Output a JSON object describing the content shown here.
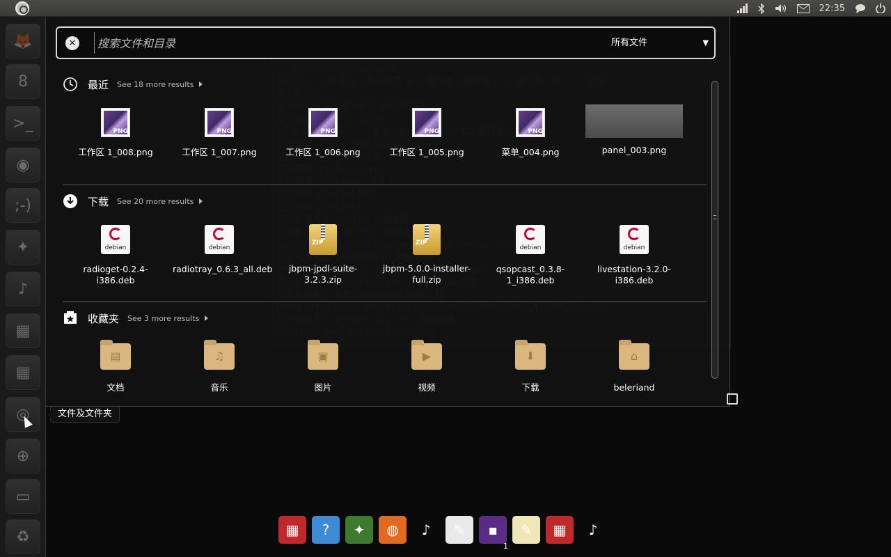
{
  "panel": {
    "clock": "22:35"
  },
  "launcher": {
    "tooltip": "文件及文件夹",
    "items": [
      {
        "name": "firefox",
        "glyph": "🦊"
      },
      {
        "name": "people",
        "glyph": "8"
      },
      {
        "name": "terminal",
        "glyph": ">_"
      },
      {
        "name": "speaker",
        "glyph": "◉"
      },
      {
        "name": "empathy",
        "glyph": ";-)"
      },
      {
        "name": "hummingbird",
        "glyph": "✦"
      },
      {
        "name": "music",
        "glyph": "♪"
      },
      {
        "name": "workspaces-1",
        "glyph": "▦"
      },
      {
        "name": "workspaces-2",
        "glyph": "▦"
      },
      {
        "name": "files-lens",
        "glyph": "◎"
      },
      {
        "name": "search-lens",
        "glyph": "⊕"
      },
      {
        "name": "drive",
        "glyph": "▭"
      },
      {
        "name": "trash",
        "glyph": "♻"
      }
    ]
  },
  "search": {
    "placeholder": "搜索文件和目录",
    "filter": "所有文件"
  },
  "groups": {
    "recent": {
      "title": "最近",
      "more": "See 18 more results",
      "items": [
        {
          "label": "工作区 1_008.png",
          "type": "png"
        },
        {
          "label": "工作区 1_007.png",
          "type": "png"
        },
        {
          "label": "工作区 1_006.png",
          "type": "png"
        },
        {
          "label": "工作区 1_005.png",
          "type": "png"
        },
        {
          "label": "菜单_004.png",
          "type": "png"
        },
        {
          "label": "panel_003.png",
          "type": "thumb"
        }
      ]
    },
    "downloads": {
      "title": "下载",
      "more": "See 20 more results",
      "items": [
        {
          "label": "radioget-0.2.4-i386.deb",
          "type": "deb"
        },
        {
          "label": "radiotray_0.6.3_all.deb",
          "type": "deb"
        },
        {
          "label": "jbpm-jpdl-suite-3.2.3.zip",
          "type": "zip"
        },
        {
          "label": "jbpm-5.0.0-installer-full.zip",
          "type": "zip"
        },
        {
          "label": "qsopcast_0.3.8-1_i386.deb",
          "type": "deb"
        },
        {
          "label": "livestation-3.2.0-i386.deb",
          "type": "deb"
        }
      ]
    },
    "favorites": {
      "title": "收藏夹",
      "more": "See 3 more results",
      "items": [
        {
          "label": "文档",
          "type": "folder",
          "emblem": "▤"
        },
        {
          "label": "音乐",
          "type": "folder",
          "emblem": "♫"
        },
        {
          "label": "图片",
          "type": "folder",
          "emblem": "▣"
        },
        {
          "label": "视频",
          "type": "folder",
          "emblem": "▶"
        },
        {
          "label": "下载",
          "type": "folder",
          "emblem": "⬇"
        },
        {
          "label": "beleriand",
          "type": "folder",
          "emblem": "⌂"
        }
      ]
    }
  },
  "tile_tags": {
    "png": "PNG",
    "deb": "debian",
    "zip": "ZIP"
  },
  "background_terminal": [
    "  liblua50 liblualib50",
    "升级了 0 个软件包，新安装了 0 个软件包，要卸载 6 个软件包，有 0 个软件",
    "包未被升级。",
    "解压缩后将会空出 54.6 MB 的空间。",
    "您希望继续执行吗？[Y/n]",
    "(正在读取数据库 ... 系统当前共安装有 个文件和目录。)",
    "正在卸载 fcitx-configtool-common ...",
    "正在卸载 kdelibs4c2a ...",
    "正在卸载 kdelibs-data ...",
    "正在卸载 libavahi-qt3-1 ...",
    "正在卸载 liblualib50 ...",
    "正在卸载 liblua50 ...",
    "正在处理用于 man-db 的触发器...",
    "正在处理用于 libc-bin 的触发器...",
    "ldconfig deferred processing now taking place",
    "正在处理用于 bamfdaemon 的触发器...",
    "Rebuilding /usr/share/applications/bamf.index...",
    "正在处理用于 desktop-file-utils 的触发器...",
    "正在处理用于 python-gmenu 的触发器...",
    "Rebuilding /usr/share/applications/desktop.zh_CN.utf8.cache...",
    "正在处理用于 python-support 的触发器...",
    "beleriand@beleriand-laptop:~$ _"
  ],
  "dock": {
    "badge": "1",
    "items": [
      {
        "name": "terminal-app",
        "glyph": "▦",
        "color": "#c0292b"
      },
      {
        "name": "help-app",
        "glyph": "?",
        "color": "#3f8ad6"
      },
      {
        "name": "hummingbird-app",
        "glyph": "✦",
        "color": "#3d7a2e"
      },
      {
        "name": "firefox-app",
        "glyph": "◍",
        "color": "#e06a1f"
      },
      {
        "name": "music-app",
        "glyph": "♪",
        "color": "#0a0a0a"
      },
      {
        "name": "editor-app",
        "glyph": "✎",
        "color": "#e9e9e9"
      },
      {
        "name": "workspace-app",
        "glyph": "▪",
        "color": "#5a2c86"
      },
      {
        "name": "notes-app",
        "glyph": "✎",
        "color": "#f0e6b8"
      },
      {
        "name": "terminal-app-2",
        "glyph": "▦",
        "color": "#c0292b"
      },
      {
        "name": "music-app-2",
        "glyph": "♪",
        "color": "#0a0a0a"
      }
    ]
  }
}
